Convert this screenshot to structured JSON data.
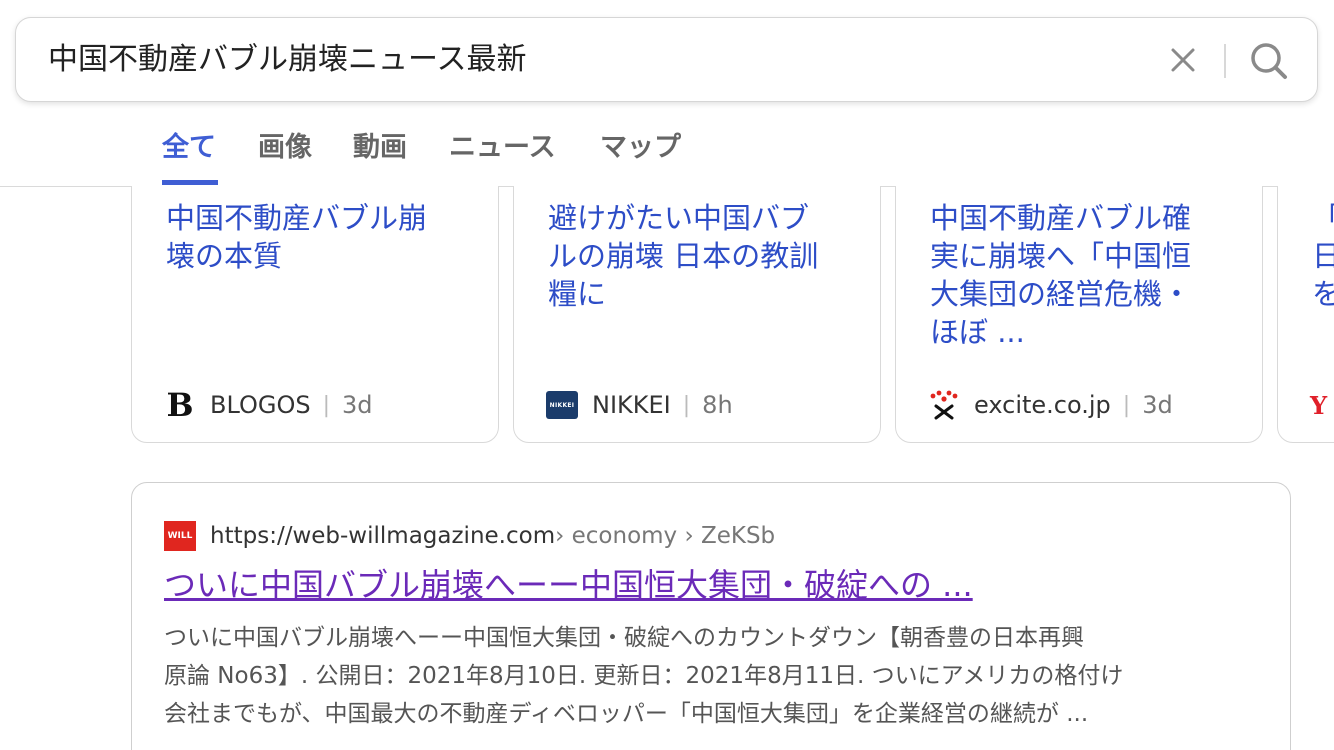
{
  "search": {
    "query": "中国不動産バブル崩壊ニュース最新"
  },
  "tabs": [
    {
      "label": "全て",
      "active": true
    },
    {
      "label": "画像",
      "active": false
    },
    {
      "label": "動画",
      "active": false
    },
    {
      "label": "ニュース",
      "active": false
    },
    {
      "label": "マップ",
      "active": false
    }
  ],
  "cards": [
    {
      "title": "中国不動産バブル崩\n壊の本質",
      "source": "BLOGOS",
      "time": "3d",
      "logo_text": "B"
    },
    {
      "title": "避けがたい中国バブ\nルの崩壊 日本の教訓\n糧に",
      "source": "NIKKEI",
      "time": "8h",
      "logo_text": "NIKKEI"
    },
    {
      "title": "中国不動産バブル確\n実に崩壊へ「中国恒\n大集団の経営危機・\nほぼ ...",
      "source": "excite.co.jp",
      "time": "3d"
    },
    {
      "title": "「\n日\nを",
      "logo_text": "Y"
    }
  ],
  "result": {
    "favicon_text": "WILL",
    "domain": "https://web-willmagazine.com",
    "path": " › economy › ZeKSb",
    "title": "ついに中国バブル崩壊へーー中国恒大集団・破綻への ...",
    "snippet": "ついに中国バブル崩壊へーー中国恒大集団・破綻へのカウントダウン【朝香豊の日本再興\n原論 No63】. 公開日：2021年8月10日. 更新日：2021年8月11日. ついにアメリカの格付け\n会社までもが、中国最大の不動産ディベロッパー「中国恒大集団」を企業経営の継続が ..."
  },
  "colors": {
    "accent": "#3f5ed4",
    "link": "#2d4dc7",
    "visited": "#6b2ab8"
  }
}
